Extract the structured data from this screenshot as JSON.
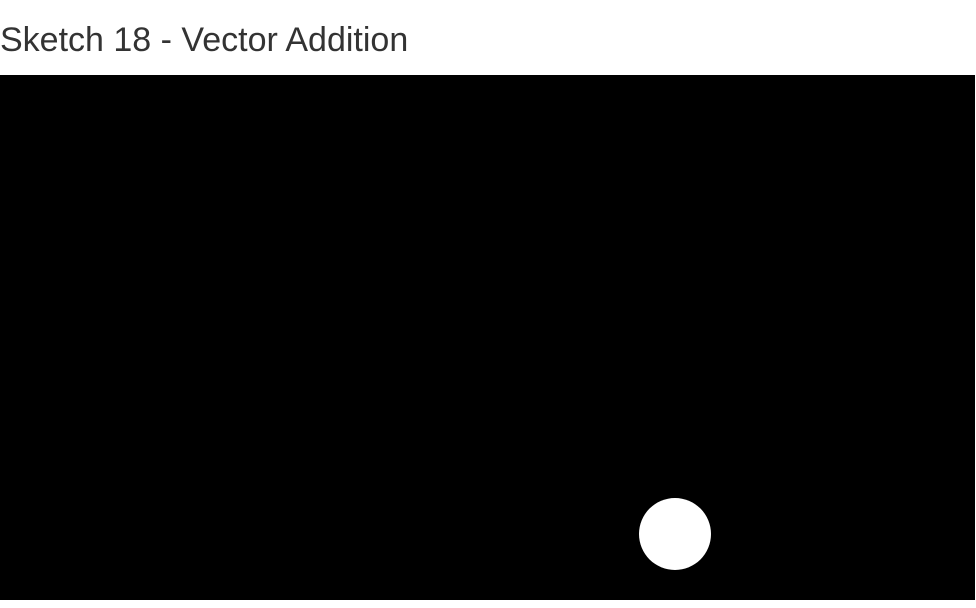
{
  "page": {
    "title": "Sketch 18 - Vector Addition"
  },
  "colors": {
    "page_background": "#ffffff",
    "title_text": "#333333",
    "canvas_background": "#000000",
    "ball_fill": "#ffffff"
  },
  "sketch": {
    "shape": "circle"
  }
}
